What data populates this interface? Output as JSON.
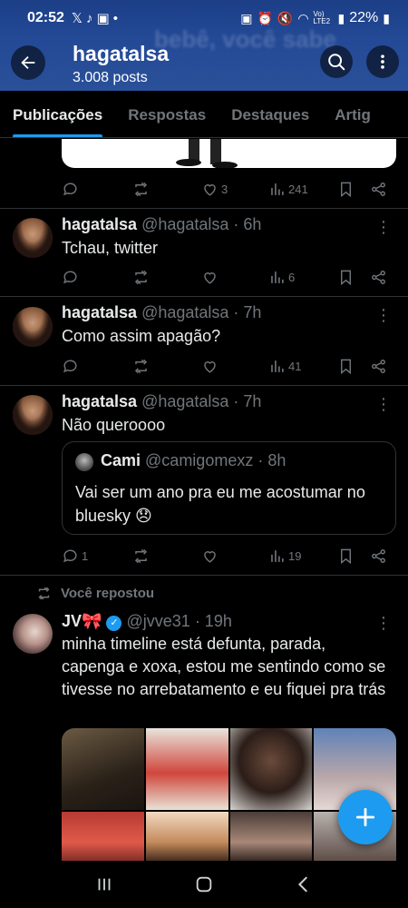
{
  "status_bar": {
    "time": "02:52",
    "battery": "22%",
    "network_label": "Vo) LTE2"
  },
  "header": {
    "name": "hagatalsa",
    "posts": "3.008 posts",
    "banner_text": "bebê, você sabe"
  },
  "tabs": [
    {
      "label": "Publicações",
      "active": true
    },
    {
      "label": "Respostas",
      "active": false
    },
    {
      "label": "Destaques",
      "active": false
    },
    {
      "label": "Artig",
      "active": false
    }
  ],
  "posts": [
    {
      "stats": {
        "replies": "",
        "reposts": "",
        "likes": "3",
        "views": "241"
      }
    },
    {
      "name": "hagatalsa",
      "handle": "@hagatalsa",
      "time": "· 6h",
      "text": "Tchau, twitter",
      "stats": {
        "replies": "",
        "reposts": "",
        "likes": "",
        "views": "6"
      }
    },
    {
      "name": "hagatalsa",
      "handle": "@hagatalsa",
      "time": "· 7h",
      "text": "Como assim apagão?",
      "stats": {
        "replies": "",
        "reposts": "",
        "likes": "",
        "views": "41"
      }
    },
    {
      "name": "hagatalsa",
      "handle": "@hagatalsa",
      "time": "· 7h",
      "text": "Não queroooo",
      "quote": {
        "name": "Cami",
        "handle": "@camigomexz",
        "time": "· 8h",
        "text": "Vai ser um ano pra eu me acostumar no bluesky 😞"
      },
      "stats": {
        "replies": "1",
        "reposts": "",
        "likes": "",
        "views": "19"
      }
    },
    {
      "repost_label": "Você repostou",
      "name": "JV",
      "name_emoji": "🎀",
      "handle": "@jvve31",
      "time": "· 19h",
      "text": "minha timeline está defunta, parada, capenga e xoxa, estou me sentindo como se tivesse no arrebatamento e eu fiquei pra trás"
    }
  ],
  "colors": {
    "accent": "#1d9bf0",
    "muted": "#71767b",
    "divider": "#2f3336",
    "header_blue": "#244a97"
  }
}
